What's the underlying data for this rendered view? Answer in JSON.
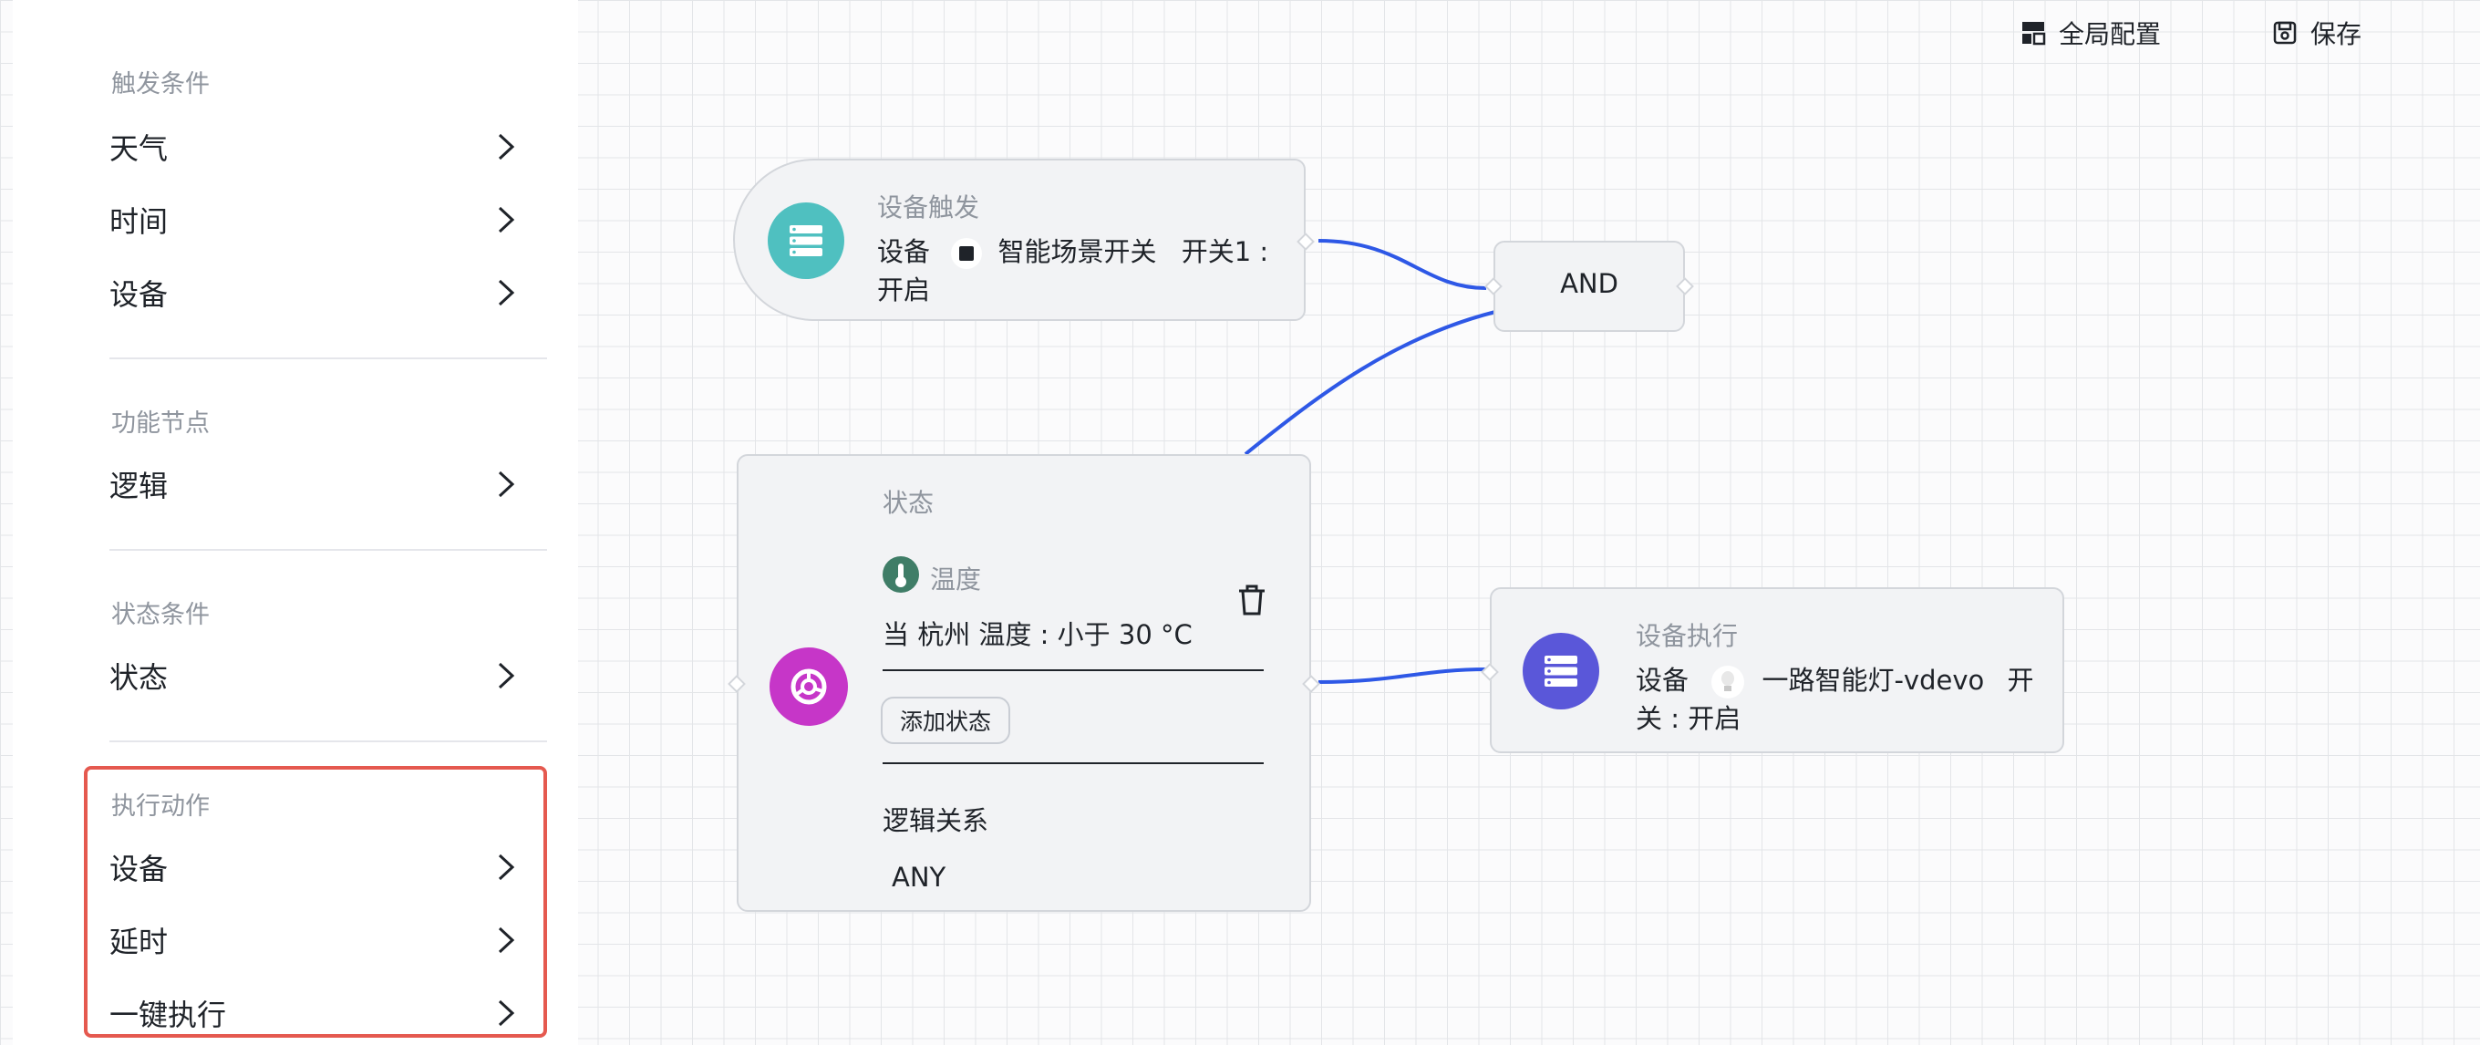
{
  "sidebar": {
    "trigger": {
      "title": "触发条件",
      "items": [
        "天气",
        "时间",
        "设备"
      ]
    },
    "function": {
      "title": "功能节点",
      "items": [
        "逻辑"
      ]
    },
    "state": {
      "title": "状态条件",
      "items": [
        "状态"
      ]
    },
    "action": {
      "title": "执行动作",
      "items": [
        "设备",
        "延时",
        "一键执行"
      ]
    }
  },
  "toolbar": {
    "global_config": "全局配置",
    "save": "保存"
  },
  "nodes": {
    "device_trigger": {
      "label": "设备触发",
      "prefix": "设备",
      "device_name": "智能场景开关",
      "condition_line1": "开关1 :",
      "condition_line2": "开启"
    },
    "and_node": {
      "label": "AND"
    },
    "state_node": {
      "label": "状态",
      "sub_label": "温度",
      "condition": "当 杭州 温度 : 小于 30 °C",
      "add_button": "添加状态",
      "logic_label": "逻辑关系",
      "logic_value": "ANY"
    },
    "device_action": {
      "label": "设备执行",
      "prefix": "设备",
      "device_name": "一路智能灯-vdevo",
      "line1_suffix": "开",
      "line2": "关 : 开启"
    }
  },
  "colors": {
    "accent_edge": "#2e58e6",
    "trigger_icon": "#4fc0c0",
    "state_icon": "#c636c8",
    "action_icon": "#5a57d9",
    "highlight": "#e5594f"
  },
  "icons": {
    "toolbar_config": "layout-icon",
    "toolbar_save": "save-icon",
    "delete": "trash-icon"
  }
}
